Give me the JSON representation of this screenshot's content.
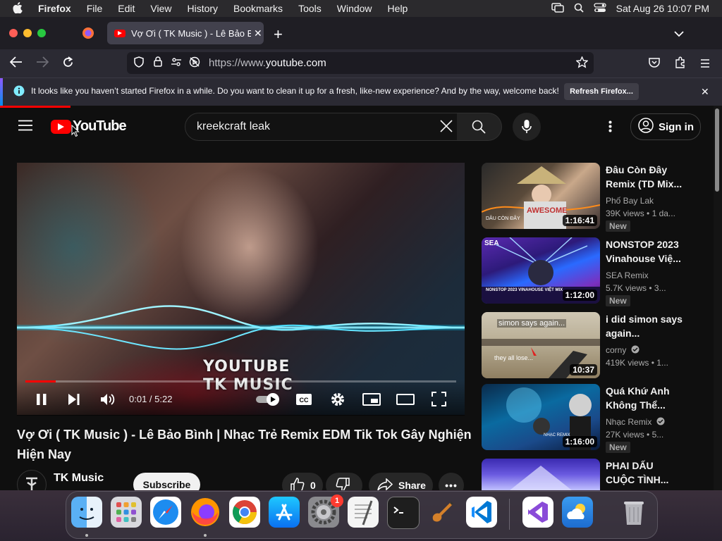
{
  "menubar": {
    "app": "Firefox",
    "items": [
      "File",
      "Edit",
      "View",
      "History",
      "Bookmarks",
      "Tools",
      "Window",
      "Help"
    ],
    "clock": "Sat Aug 26  10:07 PM"
  },
  "tab": {
    "title": "Vợ Ơi ( TK Music ) - Lê Bảo Bình"
  },
  "urlbar": {
    "url_prefix": "https://www.",
    "url_domain": "youtube.com"
  },
  "notification": {
    "message": "It looks like you haven’t started Firefox in a while. Do you want to clean it up for a fresh, like-new experience? And by the way, welcome back!",
    "button": "Refresh Firefox..."
  },
  "youtube": {
    "logo": "YouTube",
    "search_value": "kreekcraft leak",
    "signin": "Sign in",
    "player": {
      "watermark_line1": "YOUTUBE",
      "watermark_line2": "TK MUSIC",
      "time": "0:01 / 5:22",
      "progress": 0.07
    },
    "video_title": "Vợ Ơi ( TK Music ) - Lê Bảo Bình | Nhạc Trẻ Remix EDM Tik Tok Gây Nghiện Hiện Nay",
    "channel": "TK Music",
    "subscribe": "Subscribe",
    "likes": "0",
    "share": "Share",
    "recommended": [
      {
        "title1": "Đâu Còn Đây",
        "title2": "Remix (TD Mix...",
        "channel": "Phố Bay Lak",
        "views": "39K views",
        "age": "1 da...",
        "duration": "1:16:41",
        "badge": "New",
        "thumb_text": "DÂU CÒN ĐÂY",
        "thumb_brand": "AWESOME"
      },
      {
        "title1": "NONSTOP 2023",
        "title2": "Vinahouse Việ...",
        "channel": "SEA Remix",
        "views": "5.7K views",
        "age": "3...",
        "duration": "1:12:00",
        "badge": "New",
        "thumb_text": "NONSTOP 2023 VINAHOUSE VIỆT MIX",
        "thumb_brand": "SEA"
      },
      {
        "title1": "i did simon says",
        "title2": "again...",
        "channel": "corny",
        "views": "419K views",
        "age": "1...",
        "duration": "10:37",
        "badge": "",
        "thumb_text": "simon says again...",
        "thumb_text2": "they all lose..."
      },
      {
        "title1": "Quá Khứ Anh",
        "title2": "Không Thể...",
        "channel": "Nhạc Remix",
        "views": "27K views",
        "age": "5...",
        "duration": "1:16:00",
        "badge": "New",
        "thumb_text": "NHẠC REMIX"
      },
      {
        "title1": "PHAI DẤU",
        "title2": "CUỘC TÌNH...",
        "channel": "",
        "views": "",
        "age": "",
        "duration": "",
        "badge": ""
      }
    ]
  },
  "dock": {
    "apps": [
      "Finder",
      "Launchpad",
      "Safari",
      "Firefox",
      "Chrome",
      "App Store",
      "System Settings",
      "TextEdit",
      "Terminal",
      "GarageBand",
      "Visual Studio Code",
      "Visual Studio",
      "Weather",
      "Trash"
    ],
    "settings_badge": "1"
  },
  "colors": {
    "youtube_red": "#ff0000",
    "background": "#0f0f0f",
    "firefox_chrome": "#2b2a33"
  }
}
